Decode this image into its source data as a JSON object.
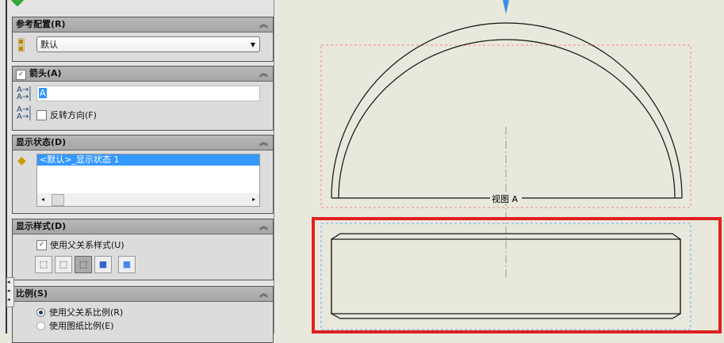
{
  "panel": {
    "ref_config": {
      "title": "参考配置(R)",
      "value": "默认"
    },
    "arrow": {
      "title": "箭头(A)",
      "label_value": "A",
      "reverse": "反转方向(F)",
      "checked": true
    },
    "display_state": {
      "title": "显示状态(D)",
      "item": "<默认>_显示状态 1"
    },
    "display_style": {
      "title": "显示样式(D)",
      "use_parent": "使用父关系样式(U)",
      "styles": [
        "wireframe",
        "hidden-lines-visible",
        "hidden-lines-removed",
        "shaded-with-edges",
        "shaded"
      ]
    },
    "scale": {
      "title": "比例(S)",
      "opt1": "使用父关系比例(R)",
      "opt2": "使用图纸比例(E)"
    }
  },
  "drawing": {
    "view_label": "视图 A"
  },
  "colors": {
    "selection": "#e02020",
    "highlight": "#3399ff"
  }
}
